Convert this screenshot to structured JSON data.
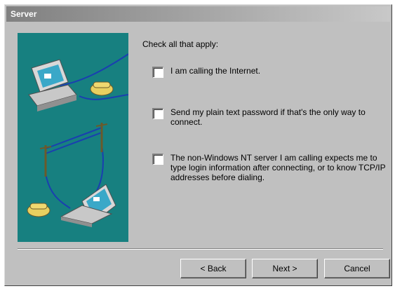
{
  "window": {
    "title": "Server"
  },
  "main": {
    "instruction": "Check all that apply:",
    "options": [
      {
        "label": "I am calling the Internet.",
        "checked": false
      },
      {
        "label": "Send my plain text password if that's the only way to connect.",
        "checked": false
      },
      {
        "label": "The non-Windows NT server I am calling expects me to type login information after connecting, or to know TCP/IP addresses before dialing.",
        "checked": false
      }
    ]
  },
  "buttons": {
    "back": "< Back",
    "next": "Next >",
    "cancel": "Cancel"
  },
  "illustration": {
    "icon": "computer-phone-laptop-network-icon",
    "background": "#178080"
  }
}
